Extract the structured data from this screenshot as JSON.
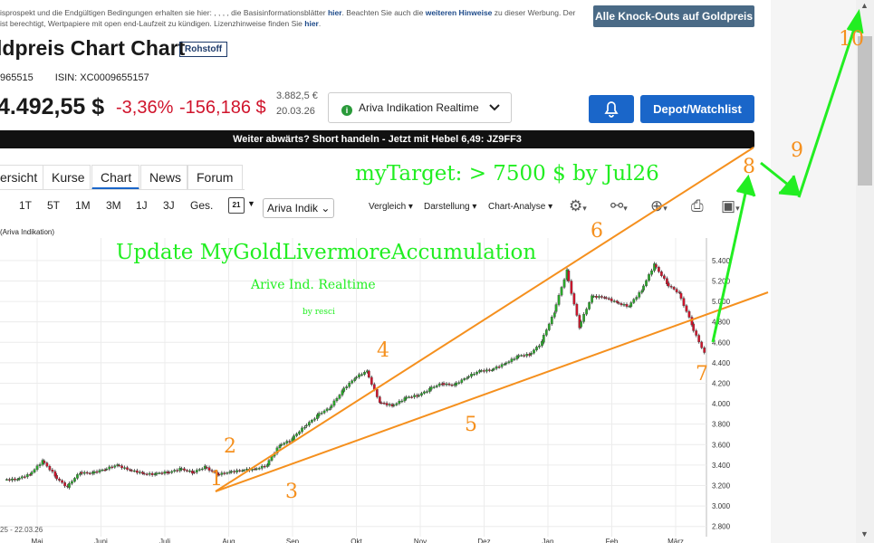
{
  "disclaimer": {
    "line1_a": "isprospekt und die Endgültigen Bedingungen erhalten sie hier: , , , , die Basisinformationsblätter ",
    "link_hier_1": "hier",
    "line1_b": ". Beachten Sie auch die ",
    "link_hinweise": "weiteren Hinweise",
    "line1_c": " zu dieser Werbung. Der",
    "line2_a": "ist berechtigt, Wertpapiere mit open end-Laufzeit zu kündigen. Lizenzhinweise finden Sie ",
    "link_hier_2": "hier",
    "line2_b": "."
  },
  "header": {
    "ko_button": "Alle Knock-Outs auf Goldpreis",
    "title": "ldpreis Chart Chart",
    "badge": "Rohstoff",
    "wkn": "965515",
    "isin_label": "ISIN:",
    "isin": "XC0009655157",
    "price": "4.492,55 $",
    "change_pct": "-3,36%",
    "change_abs": "-156,186 $",
    "ref_price": "3.882,5 €",
    "ref_date": "20.03.26",
    "source_label": "Ariva Indikation Realtime",
    "depot_button": "Depot/Watchlist"
  },
  "promo": {
    "text": "Weiter abwärts? Short handeln - Jetzt mit Hebel 6,49: JZ9FF3"
  },
  "tabs": [
    "ersicht",
    "Kurse",
    "Chart",
    "News",
    "Forum"
  ],
  "ranges": [
    "1T",
    "5T",
    "1M",
    "3M",
    "1J",
    "3J",
    "Ges."
  ],
  "toolbar": {
    "calendar_day": "21",
    "source_mini": "Ariva Indik",
    "vergleich": "Vergleich",
    "darstellung": "Darstellung",
    "analyse": "Chart-Analyse"
  },
  "chart_data": {
    "type": "candlestick",
    "series_label": "(Ariva Indikation)",
    "date_range_label": "25 - 22.03.26",
    "x_ticks": [
      "Mai",
      "Juni",
      "Juli",
      "Aug",
      "Sep",
      "Okt",
      "Nov",
      "Dez",
      "Jan",
      "Feb",
      "März"
    ],
    "y_ticks": [
      5400,
      5200,
      5000,
      4800,
      4600,
      4400,
      4200,
      4000,
      3800,
      3600,
      3400,
      3200,
      3000,
      2800
    ],
    "y_tick_labels": [
      "5.400",
      "5.200",
      "5.000",
      "4.800",
      "4.600",
      "4.400",
      "4.200",
      "4.000",
      "3.800",
      "3.600",
      "3.400",
      "3.200",
      "3.000",
      "2.800"
    ],
    "ylim": [
      2700,
      5620
    ],
    "weekly_closes": [
      3260,
      3310,
      3440,
      3300,
      3180,
      3330,
      3320,
      3360,
      3400,
      3350,
      3320,
      3310,
      3330,
      3360,
      3330,
      3380,
      3310,
      3330,
      3350,
      3360,
      3400,
      3600,
      3650,
      3780,
      3880,
      3960,
      4120,
      4250,
      4320,
      4010,
      3980,
      4050,
      4080,
      4140,
      4200,
      4180,
      4260,
      4320,
      4330,
      4390,
      4460,
      4480,
      4600,
      4900,
      5300,
      4750,
      5050,
      5040,
      4990,
      4950,
      5110,
      5360,
      5180,
      5080,
      4780,
      4492
    ]
  },
  "annotations": {
    "target_text": "myTarget: > 7500 $ by Jul26",
    "headline": "Update MyGoldLivermoreAccumulation",
    "subtitle": "Arive Ind. Realtime",
    "byline": "by resci",
    "wave_labels": [
      "1",
      "2",
      "3",
      "4",
      "5",
      "6",
      "7",
      "8",
      "9",
      "10"
    ],
    "colors": {
      "lines": "#f5901e",
      "green": "#22ee22",
      "up_candle": "#2aa82a",
      "down_candle": "#d0142c"
    }
  }
}
